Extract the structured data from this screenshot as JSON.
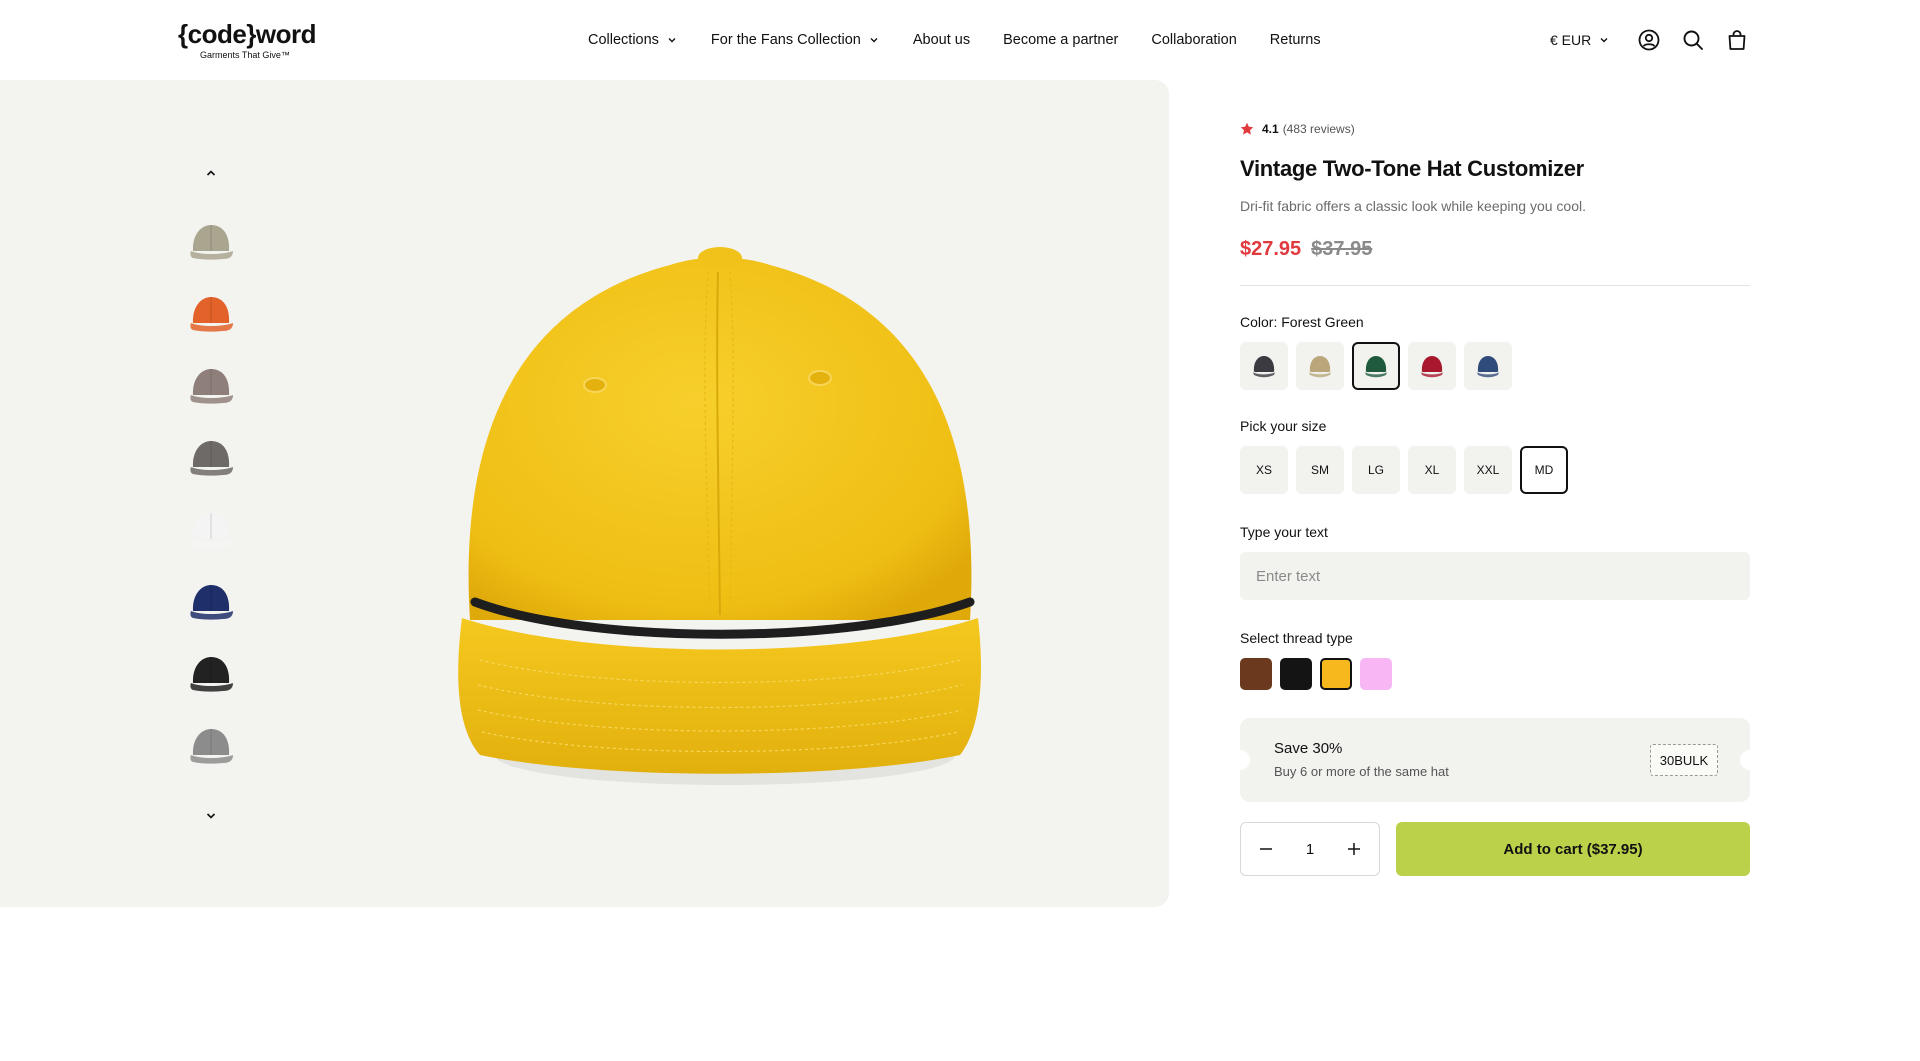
{
  "header": {
    "logo_main": "{code}word",
    "logo_sub": "Garments That Give™",
    "nav": [
      {
        "label": "Collections",
        "has_dropdown": true
      },
      {
        "label": "For the Fans Collection",
        "has_dropdown": true
      },
      {
        "label": "About us",
        "has_dropdown": false
      },
      {
        "label": "Become a partner",
        "has_dropdown": false
      },
      {
        "label": "Collaboration",
        "has_dropdown": false
      },
      {
        "label": "Returns",
        "has_dropdown": false
      }
    ],
    "currency": "€ EUR",
    "icons": [
      "account-icon",
      "search-icon",
      "cart-icon"
    ]
  },
  "gallery": {
    "thumbnails": [
      {
        "name": "khaki-cap",
        "color": "#a9a58f"
      },
      {
        "name": "orange-cap",
        "color": "#e2622a"
      },
      {
        "name": "taupe-cap-back",
        "color": "#8f7f7a"
      },
      {
        "name": "gray-cap",
        "color": "#6e6a68"
      },
      {
        "name": "white-cap",
        "color": "#f4f4f4"
      },
      {
        "name": "navy-cap",
        "color": "#1e2f6a"
      },
      {
        "name": "black-cap",
        "color": "#222222"
      },
      {
        "name": "light-gray-cap",
        "color": "#8c8c8c"
      }
    ],
    "main_image_color": "#f2c21b"
  },
  "product": {
    "rating": "4.1",
    "reviews": "(483 reviews)",
    "title": "Vintage Two-Tone Hat Customizer",
    "description": "Dri-fit fabric offers a classic look while keeping you cool.",
    "price_sale": "$27.95",
    "price_old": "$37.95",
    "color_label": "Color: Forest Green",
    "colors": [
      {
        "name": "charcoal",
        "hex": "#3a3a40",
        "selected": false
      },
      {
        "name": "khaki",
        "hex": "#b9a67a",
        "selected": false
      },
      {
        "name": "forest-green",
        "hex": "#1f5a3c",
        "selected": true
      },
      {
        "name": "red",
        "hex": "#a8172b",
        "selected": false
      },
      {
        "name": "navy",
        "hex": "#2f4b7c",
        "selected": false
      }
    ],
    "size_label": "Pick your size",
    "sizes": [
      {
        "label": "XS",
        "selected": false
      },
      {
        "label": "SM",
        "selected": false
      },
      {
        "label": "LG",
        "selected": false
      },
      {
        "label": "XL",
        "selected": false
      },
      {
        "label": "XXL",
        "selected": false
      },
      {
        "label": "MD",
        "selected": true
      }
    ],
    "text_label": "Type your text",
    "text_placeholder": "Enter text",
    "thread_label": "Select thread type",
    "threads": [
      {
        "name": "brown",
        "hex": "#6b3a1e",
        "selected": false
      },
      {
        "name": "black",
        "hex": "#141414",
        "selected": false
      },
      {
        "name": "gold",
        "hex": "#f7b81e",
        "selected": true
      },
      {
        "name": "pink",
        "hex": "#f9b6f4",
        "selected": false
      }
    ],
    "promo_title": "Save 30%",
    "promo_sub": "Buy 6 or more of the same hat",
    "promo_code": "30BULK",
    "quantity": "1",
    "add_to_cart": "Add to cart ($37.95)"
  },
  "colors": {
    "sale": "#e0393e",
    "add_to_cart_bg": "#bcd14a",
    "gallery_bg": "#f3f3f0"
  }
}
